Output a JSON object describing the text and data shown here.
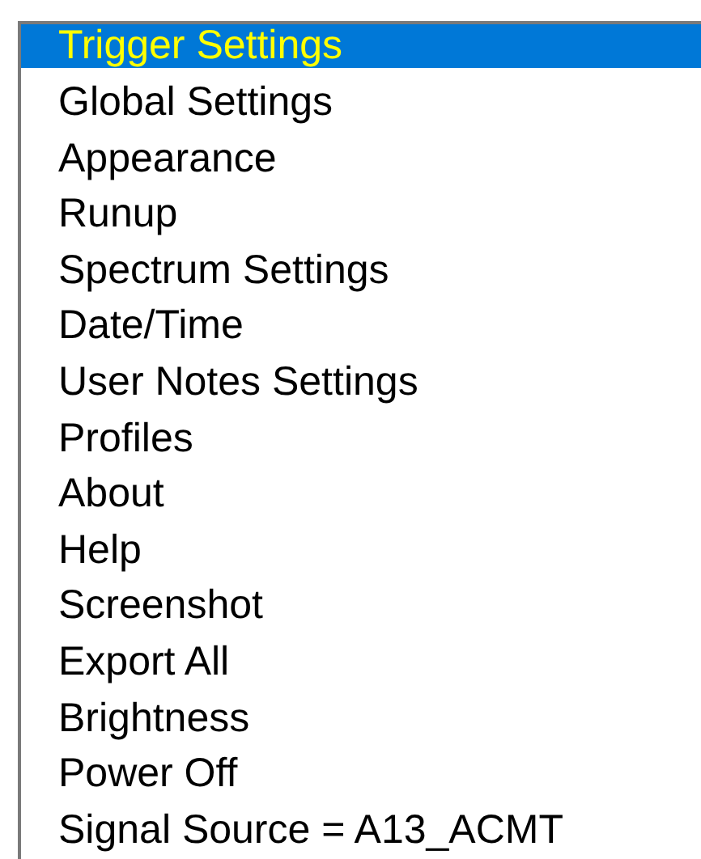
{
  "menu": {
    "items": [
      {
        "label": "Trigger Settings",
        "selected": true
      },
      {
        "label": "Global Settings",
        "selected": false
      },
      {
        "label": "Appearance",
        "selected": false
      },
      {
        "label": "Runup",
        "selected": false
      },
      {
        "label": "Spectrum Settings",
        "selected": false
      },
      {
        "label": "Date/Time",
        "selected": false
      },
      {
        "label": "User Notes Settings",
        "selected": false
      },
      {
        "label": "Profiles",
        "selected": false
      },
      {
        "label": "About",
        "selected": false
      },
      {
        "label": "Help",
        "selected": false
      },
      {
        "label": "Screenshot",
        "selected": false
      },
      {
        "label": "Export All",
        "selected": false
      },
      {
        "label": "Brightness",
        "selected": false
      },
      {
        "label": "Power Off",
        "selected": false
      },
      {
        "label": "Signal Source = A13_ACMT",
        "selected": false
      }
    ]
  }
}
